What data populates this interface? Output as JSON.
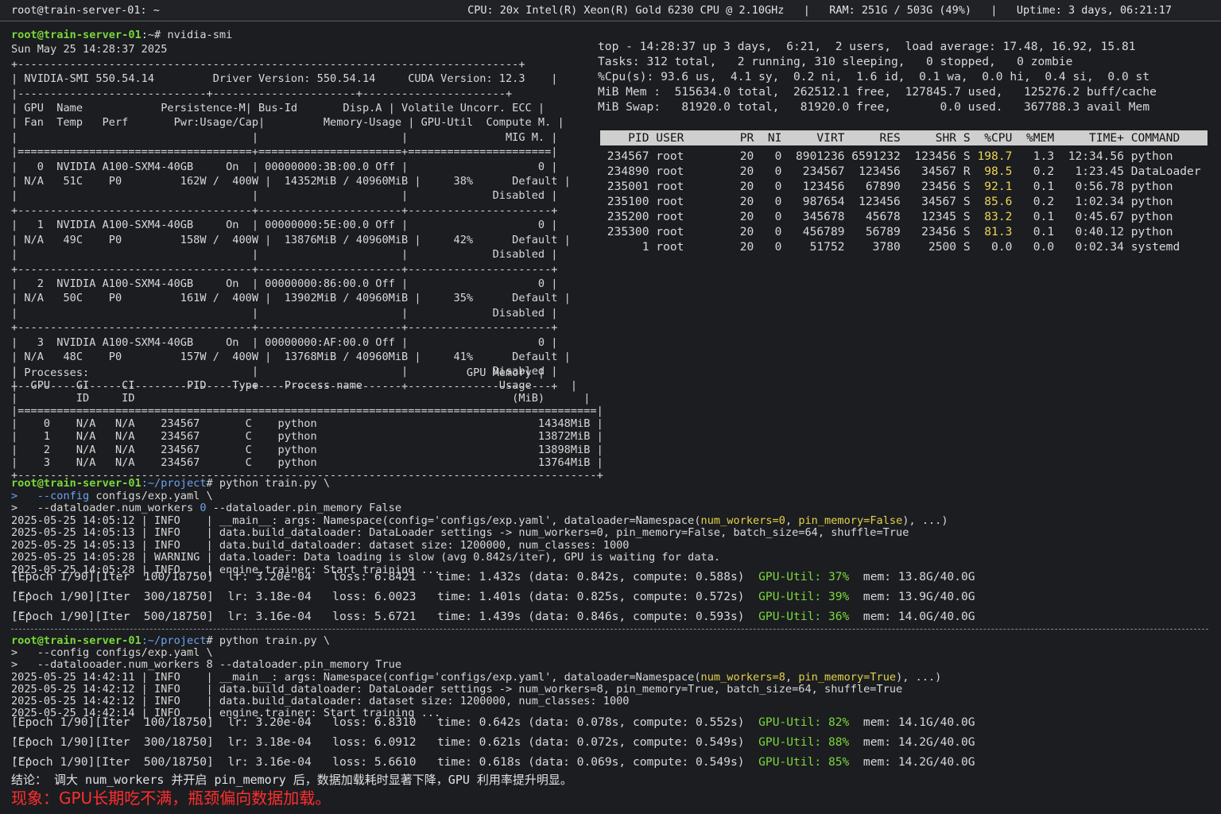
{
  "titlebar": {
    "host": "root@train-server-01: ~",
    "stats": "CPU: 20x Intel(R) Xeon(R) Gold 6230 CPU @ 2.10GHz   |   RAM: 251G / 503G (49%)   |   Uptime: 3 days, 06:21:17"
  },
  "smi_prompt": {
    "userhost": "root@train-server-01",
    "path": ":~# ",
    "cmd": "nvidia-smi"
  },
  "smi": {
    "date": "Sun May 25 14:28:37 2025",
    "sep_top": "+-----------------------------------------------------------------------------+",
    "version_line": "| NVIDIA-SMI 550.54.14         Driver Version: 550.54.14     CUDA Version: 12.3    |",
    "sep_mid": "|-----------------------------+----------------------+----------------------+",
    "hdr1": "| GPU  Name            Persistence-M| Bus-Id       Disp.A | Volatile Uncorr. ECC |",
    "hdr2": "| Fan  Temp   Perf       Pwr:Usage/Cap|         Memory-Usage | GPU-Util  Compute M. |",
    "hdr3": "|                                    |                      |               MIG M. |",
    "sep_eq": "|====================================+======================+======================|",
    "sep_row": "+------------------------------------+----------------------+----------------------+",
    "gpus": [
      {
        "l1": "|   0  NVIDIA A100-SXM4-40GB     On  | 00000000:3B:00.0 Off |                    0 |",
        "l2": "| N/A   51C    P0         162W /  400W |  14352MiB / 40960MiB |     38%      Default |",
        "l3": "|                                    |                      |             Disabled |"
      },
      {
        "l1": "|   1  NVIDIA A100-SXM4-40GB     On  | 00000000:5E:00.0 Off |                    0 |",
        "l2": "| N/A   49C    P0         158W /  400W |  13876MiB / 40960MiB |     42%      Default |",
        "l3": "|                                    |                      |             Disabled |"
      },
      {
        "l1": "|   2  NVIDIA A100-SXM4-40GB     On  | 00000000:86:00.0 Off |                    0 |",
        "l2": "| N/A   50C    P0         161W /  400W |  13902MiB / 40960MiB |     35%      Default |",
        "l3": "|                                    |                      |             Disabled |"
      },
      {
        "l1": "|   3  NVIDIA A100-SXM4-40GB     On  | 00000000:AF:00.0 Off |                    0 |",
        "l2": "| N/A   48C    P0         157W /  400W |  13768MiB / 40960MiB |     41%      Default |",
        "l3": "|                                    |                      |             Disabled |"
      }
    ],
    "proc_hdr1": "| Processes:                                                          GPU Memory |",
    "proc_hdr2": "|  GPU    GI     CI        PID    Type    Process name                     Usage      |",
    "proc_hdr3": "|         ID     ID                                                          (MiB)      |",
    "proc_eq": "|=========================================================================================|",
    "processes": [
      "|    0    N/A   N/A    234567       C    python                                  14348MiB |",
      "|    1    N/A   N/A    234567       C    python                                  13872MiB |",
      "|    2    N/A   N/A    234567       C    python                                  13898MiB |",
      "|    3    N/A   N/A    234567       C    python                                  13764MiB |"
    ],
    "proc_bottom": "+-----------------------------------------------------------------------------------------+"
  },
  "top": {
    "summary": [
      "top - 14:28:37 up 3 days,  6:21,  2 users,  load average: 17.48, 16.92, 15.81",
      "Tasks: 312 total,   2 running, 310 sleeping,   0 stopped,   0 zombie",
      "%Cpu(s): 93.6 us,  4.1 sy,  0.2 ni,  1.6 id,  0.1 wa,  0.0 hi,  0.4 si,  0.0 st",
      "MiB Mem :  515634.0 total,  262512.1 free,  127845.7 used,   125276.2 buff/cache",
      "MiB Swap:   81920.0 total,   81920.0 free,       0.0 used.   367788.3 avail Mem"
    ],
    "columns": "    PID USER        PR  NI     VIRT     RES     SHR S  %CPU  %MEM     TIME+ COMMAND",
    "rows": [
      {
        "pre": " 234567 root        20   0  8901236 6591232  123456 S ",
        "cpu": "198.7",
        "post": "   1.3  12:34.56 python",
        "hot": true
      },
      {
        "pre": " 234890 root        20   0   234567  123456   34567 R  ",
        "cpu": "98.5",
        "post": "   0.2   1:23.45 DataLoader",
        "hot": true
      },
      {
        "pre": " 235001 root        20   0   123456   67890   23456 S  ",
        "cpu": "92.1",
        "post": "   0.1   0:56.78 python",
        "hot": true
      },
      {
        "pre": " 235100 root        20   0   987654  123456   34567 S  ",
        "cpu": "85.6",
        "post": "   0.2   1:02.34 python",
        "hot": true
      },
      {
        "pre": " 235200 root        20   0   345678   45678   12345 S  ",
        "cpu": "83.2",
        "post": "   0.1   0:45.67 python",
        "hot": true
      },
      {
        "pre": " 235300 root        20   0   456789   56789   23456 S  ",
        "cpu": "81.3",
        "post": "   0.1   0:40.12 python",
        "hot": true
      },
      {
        "pre": "      1 root        20   0    51752    3780    2500 S   ",
        "cpu": "0.0",
        "post": "   0.0   0:02.34 systemd",
        "hot": false
      }
    ]
  },
  "run1": {
    "userhost": "root@train-server-01",
    "path": ":~/project",
    "cmd": "# python train.py \\",
    "cont1_prefix": ">   ",
    "cont1_flag": "--config",
    "cont1_rest": " configs/exp.yaml \\",
    "cont2_prefix": ">   --dataloader.num_workers ",
    "cont2_val": "0",
    "cont2_rest": " --dataloader.pin_memory False",
    "logs": [
      {
        "t": "2025-05-25 14:05:12 | INFO    | __main__: args: Namespace(config='configs/exp.yaml', dataloader=Namespace(",
        "a": "num_workers=0",
        "m": ", ",
        "b": "pin_memory=False",
        "e": "), ...)"
      },
      {
        "t": "2025-05-25 14:05:13 | INFO    | data.build_dataloader: DataLoader settings -> num_workers=0, pin_memory=False, batch_size=64, shuffle=True"
      },
      {
        "t": "2025-05-25 14:05:13 | INFO    | data.build_dataloader: dataset size: 1200000, num_classes: 1000"
      },
      {
        "t": "2025-05-25 14:05:28 | WARNING | data.loader: Data loading is slow (avg 0.842s/iter), GPU is waiting for data."
      },
      {
        "t": "2025-05-25 14:05:28 | INFO    | engine.trainer: Start training ..."
      }
    ],
    "iters": [
      {
        "pre": "[Epoch 1/90][Iter  100/18750]  lr: 3.20e-04   loss: 6.8421   time: 1.432s (data: 0.842s, compute: 0.588s)  ",
        "gpu": "GPU-Util: 37%",
        "mem": "  mem: 13.8G/40.0G"
      },
      {
        "pre": "[Epoch 1/90][Iter  300/18750]  lr: 3.18e-04   loss: 6.0023   time: 1.401s (data: 0.825s, compute: 0.572s)  ",
        "gpu": "GPU-Util: 39%",
        "mem": "  mem: 13.9G/40.0G"
      },
      {
        "pre": "[Epoch 1/90][Iter  500/18750]  lr: 3.16e-04   loss: 5.6721   time: 1.439s (data: 0.846s, compute: 0.593s)  ",
        "gpu": "GPU-Util: 36%",
        "mem": "  mem: 14.0G/40.0G"
      }
    ],
    "ellipsis": "..."
  },
  "run2": {
    "userhost": "root@train-server-01",
    "path": ":~/project",
    "cmd": "# python train.py \\",
    "cont1": ">   --config configs/exp.yaml \\",
    "cont2": ">   --datalooader.num_workers 8 --dataloader.pin_memory True",
    "logs": [
      {
        "t": "2025-05-25 14:42:11 | INFO    | __main__: args: Namespace(config='configs/exp.yaml', dataloader=Namespace(",
        "a": "num_workers=8",
        "m": ", ",
        "b": "pin_memory=True",
        "e": "), ...)"
      },
      {
        "t": "2025-05-25 14:42:12 | INFO    | data.build_dataloader: DataLoader settings -> num_workers=8, pin_memory=True, batch_size=64, shuffle=True"
      },
      {
        "t": "2025-05-25 14:42:12 | INFO    | data.build_dataloader: dataset size: 1200000, num_classes: 1000"
      },
      {
        "t": "2025-05-25 14:42:14 | INFO    | engine.trainer: Start training ..."
      }
    ],
    "iters": [
      {
        "pre": "[Epoch 1/90][Iter  100/18750]  lr: 3.20e-04   loss: 6.8310   time: 0.642s (data: 0.078s, compute: 0.552s)  ",
        "gpu": "GPU-Util: 82%",
        "mem": "  mem: 14.1G/40.0G"
      },
      {
        "pre": "[Epoch 1/90][Iter  300/18750]  lr: 3.18e-04   loss: 6.0912   time: 0.621s (data: 0.072s, compute: 0.549s)  ",
        "gpu": "GPU-Util: 88%",
        "mem": "  mem: 14.2G/40.0G"
      },
      {
        "pre": "[Epoch 1/90][Iter  500/18750]  lr: 3.16e-04   loss: 5.6610   time: 0.618s (data: 0.069s, compute: 0.549s)  ",
        "gpu": "GPU-Util: 85%",
        "mem": "  mem: 14.2G/40.0G"
      }
    ],
    "ellipsis": "..."
  },
  "conclusion": "结论： 调大 num_workers 并开启 pin_memory 后，数据加载耗时显著下降，GPU 利用率提升明显。",
  "phenomenon": "现象：GPU长期吃不满，瓶颈偏向数据加载。",
  "colors": {
    "background": "#1b1d20",
    "prompt_green": "#7ad83a",
    "path_blue": "#6ea2ef",
    "highlight_yellow": "#e3d24a",
    "alert_red": "#ff2e2e",
    "top_header_bg": "#cfcfcf"
  }
}
